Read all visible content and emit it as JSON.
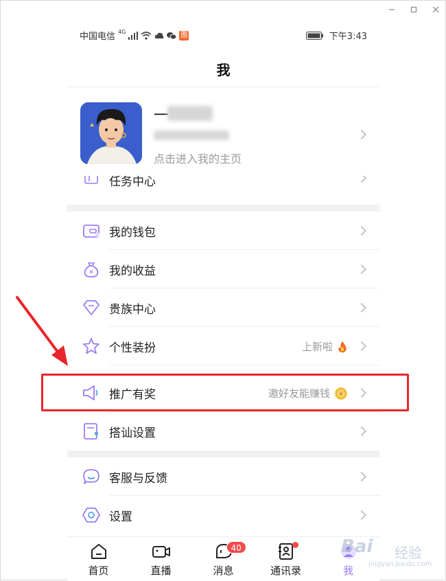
{
  "window": {
    "controls": [
      "minimize",
      "maximize",
      "close"
    ]
  },
  "status_bar": {
    "carrier": "中国电信",
    "network": "4G",
    "app_badge": "图",
    "time": "下午3:43"
  },
  "header": {
    "title": "我"
  },
  "profile": {
    "name_visible": "一",
    "hint": "点击进入我的主页"
  },
  "menu": {
    "partial_item": "任务中心",
    "group1": [
      {
        "label": "我的钱包",
        "icon": "wallet-icon"
      },
      {
        "label": "我的收益",
        "icon": "money-bag-icon"
      },
      {
        "label": "贵族中心",
        "icon": "diamond-icon"
      },
      {
        "label": "个性装扮",
        "icon": "star-icon",
        "right_text": "上新啦",
        "right_icon": "fire-icon"
      },
      {
        "label": "推广有奖",
        "icon": "speaker-icon",
        "right_text": "邀好友能赚钱",
        "right_icon": "coin-icon"
      },
      {
        "label": "搭讪设置",
        "icon": "heart-card-icon"
      }
    ],
    "group2": [
      {
        "label": "客服与反馈",
        "icon": "chat-bubble-icon"
      },
      {
        "label": "设置",
        "icon": "settings-icon"
      }
    ]
  },
  "tabbar": {
    "tabs": [
      {
        "label": "首页",
        "icon": "home-icon"
      },
      {
        "label": "直播",
        "icon": "video-camera-icon"
      },
      {
        "label": "消息",
        "icon": "message-icon",
        "badge": "40"
      },
      {
        "label": "通讯录",
        "icon": "contacts-icon",
        "dot": true
      },
      {
        "label": "我",
        "icon": "profile-icon",
        "active": true
      }
    ]
  },
  "watermark": {
    "brand": "Bai",
    "cn": "经验",
    "url": "jingyan.baidu.com"
  },
  "colors": {
    "accent": "#9a7cf5",
    "annotation": "#e8262b",
    "badge": "#f24a4a"
  }
}
